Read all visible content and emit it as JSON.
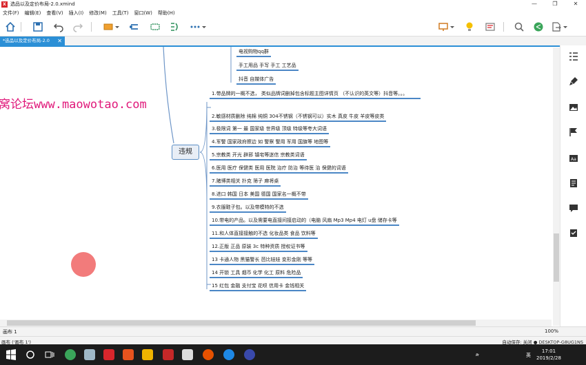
{
  "window": {
    "title": "选品以及定价布局-2.0.xmind",
    "app_icon": "X",
    "minimize": "—",
    "maximize": "❐",
    "close": "✕"
  },
  "menu": [
    "文件(F)",
    "编辑(E)",
    "查看(V)",
    "插入(I)",
    "修改(M)",
    "工具(T)",
    "窗口(W)",
    "帮助(H)"
  ],
  "tab": {
    "label": "*选品以及定价布局-2.0",
    "close": "✕"
  },
  "watermark": "窝论坛www.maowotao.com",
  "mindmap": {
    "central": "违规",
    "top_nodes": [
      "电视购物qq群",
      "手工用品 手写 手工 工艺品",
      "抖音 自媒体广告"
    ],
    "branches": [
      "1.带品牌的一概不选， 类似品牌词删掉包含标题主图详情页 （不认识的英文等）抖音等。。。",
      "2.敏感材质删除  纯棉  纯铜  304不锈钢（不锈钢可以）实木 真皮 牛皮 羊皮等皮类",
      "3.极限词  第一  最  国家级  世界级  顶级  特级等夸大词语",
      "4.军警  国家政府擦边  如  警察  警用  军用  国旗等  地图等",
      "5.宗教类  开光  辟邪  镇宅等迷信  宗教类词语",
      "6.医用  医疗  保健类  医用  医院  治疗  防治  等待医  治  保健的词语",
      "7.赌博类相关  扑克  筛子  麻将桌",
      "8.进口  韩国  日本  美国  德国  国家名一概不带",
      "9.衣服鞋子包。以及带模特的不选",
      "10.带电的产品。以及需要电直接间接启动的（电脑 风扇 Mp3 Mp4 电灯 u盘 储存卡等",
      "11.和人体直接接触的不选  化妆品类  食品  饮料等",
      "12.正版  正品  原装  3c  特种资质  授权证书等",
      "13 卡通人物  黑猫警长  芭比娃娃  变形金刚  等等",
      "14  开锁  工具  烟币  化学  化工  原料  危险品",
      "15  红包  金融  支付宝  花呗  信用卡  金钱相关"
    ]
  },
  "sheet": {
    "label": "画布 1",
    "zoom": "100%"
  },
  "status": {
    "left": "画布 ('画布 1')",
    "right": "自动保存: 关闭  ●  DESKTOP-G8UG1NS"
  },
  "taskbar": {
    "time": "17:01",
    "date": "2019/2/28",
    "lang": "英"
  },
  "colors": {
    "accent": "#2b8fd6",
    "node_underline": "#4a86c5",
    "watermark": "#e0187a"
  }
}
